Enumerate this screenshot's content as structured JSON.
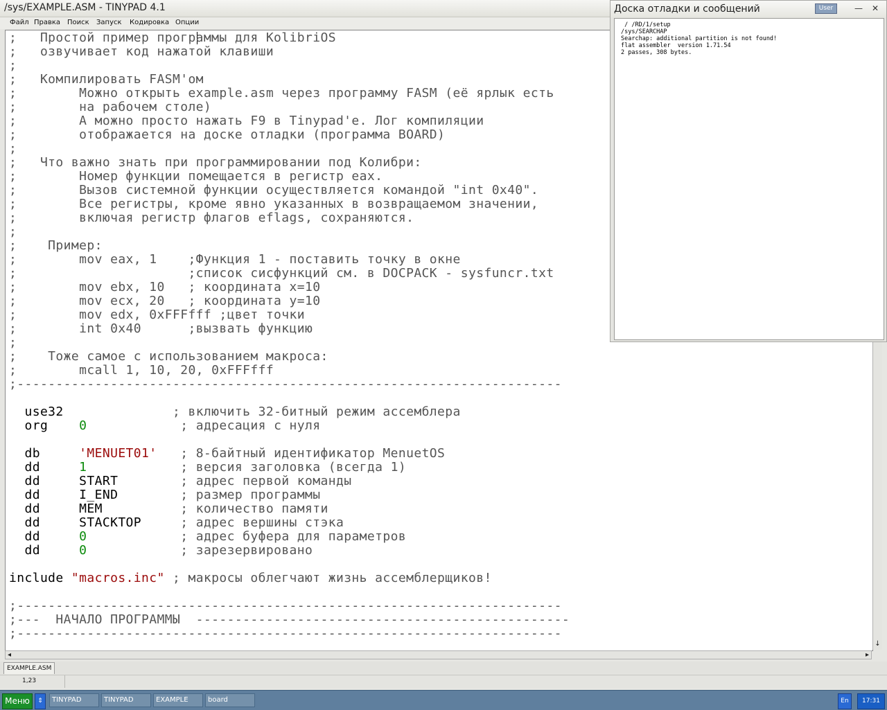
{
  "tinypad": {
    "title": "/sys/EXAMPLE.ASM - TINYPAD 4.1",
    "menu": [
      "Файл",
      "Правка",
      "Поиск",
      "Запуск",
      "Кодировка",
      "Опции"
    ],
    "code_lines": [
      [
        {
          "t": ";   Простой пример программы для KolibriOS",
          "c": "comment"
        }
      ],
      [
        {
          "t": ";   озвучивает код нажатой клавиши",
          "c": "comment"
        }
      ],
      [
        {
          "t": ";",
          "c": "comment"
        }
      ],
      [
        {
          "t": ";   Компилировать FASM'ом",
          "c": "comment"
        }
      ],
      [
        {
          "t": ";        Можно открыть example.asm через программу FASM (её ярлык есть",
          "c": "comment"
        }
      ],
      [
        {
          "t": ";        на рабочем столе)",
          "c": "comment"
        }
      ],
      [
        {
          "t": ";        А можно просто нажать F9 в Tinypad'е. Лог компиляции",
          "c": "comment"
        }
      ],
      [
        {
          "t": ";        отображается на доске отладки (программа BOARD)",
          "c": "comment"
        }
      ],
      [
        {
          "t": ";",
          "c": "comment"
        }
      ],
      [
        {
          "t": ";   Что важно знать при программировании под Колибри:",
          "c": "comment"
        }
      ],
      [
        {
          "t": ";        Номер функции помещается в регистр eax.",
          "c": "comment"
        }
      ],
      [
        {
          "t": ";        Вызов системной функции осуществляется командой \"int 0x40\".",
          "c": "comment"
        }
      ],
      [
        {
          "t": ";        Все регистры, кроме явно указанных в возвращаемом значении,",
          "c": "comment"
        }
      ],
      [
        {
          "t": ";        включая регистр флагов eflags, сохраняются.",
          "c": "comment"
        }
      ],
      [
        {
          "t": ";",
          "c": "comment"
        }
      ],
      [
        {
          "t": ";    Пример:",
          "c": "comment"
        }
      ],
      [
        {
          "t": ";        mov eax, 1    ;Функция 1 - поставить точку в окне",
          "c": "comment"
        }
      ],
      [
        {
          "t": ";                      ;список сисфункций см. в DOCPACK - sysfuncr.txt",
          "c": "comment"
        }
      ],
      [
        {
          "t": ";        mov ebx, 10   ; координата x=10",
          "c": "comment"
        }
      ],
      [
        {
          "t": ";        mov ecx, 20   ; координата y=10",
          "c": "comment"
        }
      ],
      [
        {
          "t": ";        mov edx, 0xFFFfff ;цвет точки",
          "c": "comment"
        }
      ],
      [
        {
          "t": ";        int 0x40      ;вызвать функцию",
          "c": "comment"
        }
      ],
      [
        {
          "t": ";",
          "c": "comment"
        }
      ],
      [
        {
          "t": ";    Тоже самое с использованием макроса:",
          "c": "comment"
        }
      ],
      [
        {
          "t": ";        mcall 1, 10, 20, 0xFFFfff",
          "c": "comment"
        }
      ],
      [
        {
          "t": ";----------------------------------------------------------------------",
          "c": "comment"
        }
      ],
      [
        {
          "t": "",
          "c": "plain"
        }
      ],
      [
        {
          "t": "  use32",
          "c": "plain"
        },
        {
          "t": "              ; включить 32-битный режим ассемблера",
          "c": "comment"
        }
      ],
      [
        {
          "t": "  org    ",
          "c": "plain"
        },
        {
          "t": "0",
          "c": "number"
        },
        {
          "t": "            ; адресация с нуля",
          "c": "comment"
        }
      ],
      [
        {
          "t": "",
          "c": "plain"
        }
      ],
      [
        {
          "t": "  db     ",
          "c": "plain"
        },
        {
          "t": "'MENUET01'",
          "c": "string"
        },
        {
          "t": "   ; 8-байтный идентификатор MenuetOS",
          "c": "comment"
        }
      ],
      [
        {
          "t": "  dd     ",
          "c": "plain"
        },
        {
          "t": "1",
          "c": "number"
        },
        {
          "t": "            ; версия заголовка (всегда 1)",
          "c": "comment"
        }
      ],
      [
        {
          "t": "  dd     START",
          "c": "plain"
        },
        {
          "t": "        ; адрес первой команды",
          "c": "comment"
        }
      ],
      [
        {
          "t": "  dd     I_END",
          "c": "plain"
        },
        {
          "t": "        ; размер программы",
          "c": "comment"
        }
      ],
      [
        {
          "t": "  dd     MEM",
          "c": "plain"
        },
        {
          "t": "          ; количество памяти",
          "c": "comment"
        }
      ],
      [
        {
          "t": "  dd     STACKTOP",
          "c": "plain"
        },
        {
          "t": "     ; адрес вершины стэка",
          "c": "comment"
        }
      ],
      [
        {
          "t": "  dd     ",
          "c": "plain"
        },
        {
          "t": "0",
          "c": "number"
        },
        {
          "t": "            ; адрес буфера для параметров",
          "c": "comment"
        }
      ],
      [
        {
          "t": "  dd     ",
          "c": "plain"
        },
        {
          "t": "0",
          "c": "number"
        },
        {
          "t": "            ; зарезервировано",
          "c": "comment"
        }
      ],
      [
        {
          "t": "",
          "c": "plain"
        }
      ],
      [
        {
          "t": "include ",
          "c": "plain"
        },
        {
          "t": "\"macros.inc\"",
          "c": "string"
        },
        {
          "t": " ; макросы облегчают жизнь ассемблерщиков!",
          "c": "comment"
        }
      ],
      [
        {
          "t": "",
          "c": "plain"
        }
      ],
      [
        {
          "t": ";----------------------------------------------------------------------",
          "c": "comment"
        }
      ],
      [
        {
          "t": ";---  НАЧАЛО ПРОГРАММЫ  ------------------------------------------------",
          "c": "comment"
        }
      ],
      [
        {
          "t": ";----------------------------------------------------------------------",
          "c": "comment"
        }
      ]
    ],
    "scroll_down_arrow": "↓",
    "scroll_left_arrow": "◂",
    "scroll_right_arrow": "▸",
    "tab_label": "EXAMPLE.ASM",
    "cursor_position": "1,23"
  },
  "board": {
    "title": "Доска отладки и сообщений",
    "user_button": "User",
    "minimize": "—",
    "close": "✕",
    "log": [
      " / /RD/1/setup",
      "/sys/SEARCHAP",
      "Searchap: additional partition is not found!",
      "flat assembler  version 1.71.54",
      "2 passes, 308 bytes."
    ]
  },
  "taskbar": {
    "menu_label": "Меню",
    "switcher": "⇕",
    "tasks": [
      "TINYPAD",
      "TINYPAD",
      "EXAMPLE",
      "board"
    ],
    "language": "En",
    "clock": "17:31"
  },
  "colors": {
    "comment": "#555555",
    "number": "#0a8a0a",
    "string": "#9b0a0a",
    "menu_button": "#1a8f2a",
    "taskbar": "#5f7f9e"
  }
}
